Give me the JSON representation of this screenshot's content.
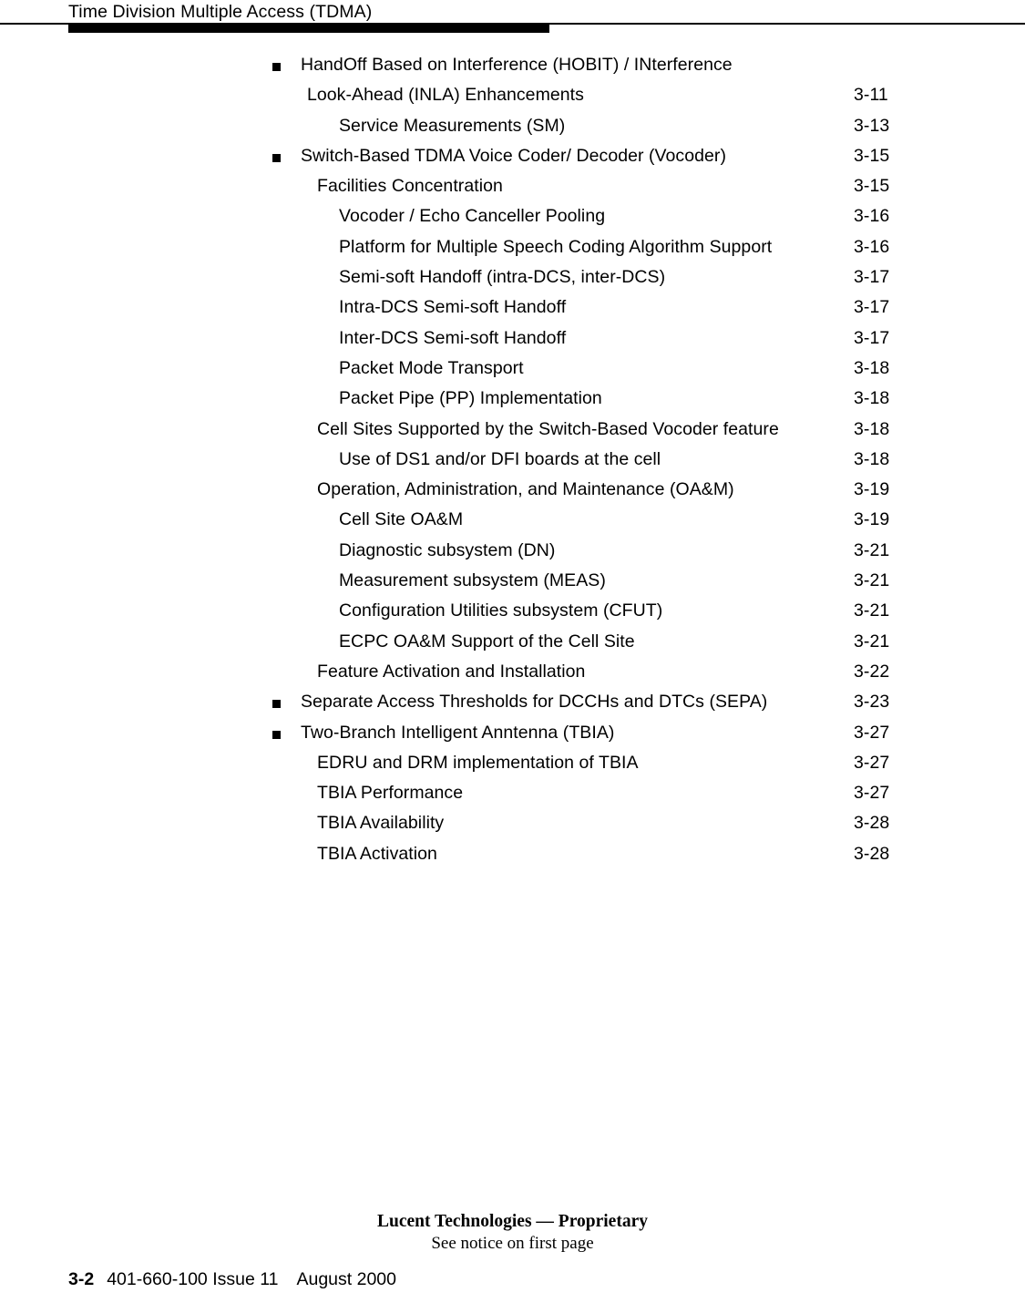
{
  "header": {
    "running_head": "Time Division Multiple Access (TDMA)"
  },
  "toc": {
    "rows": [
      {
        "level": 1,
        "bullet": true,
        "label": "HandOff Based on Interference (HOBIT) / INterference",
        "page": ""
      },
      {
        "level": "1c",
        "bullet": false,
        "label": "Look-Ahead (INLA) Enhancements",
        "page": "3-11"
      },
      {
        "level": 3,
        "bullet": false,
        "label": "Service Measurements (SM)",
        "page": "3-13"
      },
      {
        "level": 1,
        "bullet": true,
        "label": "Switch-Based TDMA Voice Coder/ Decoder (Vocoder)",
        "page": "3-15"
      },
      {
        "level": 2,
        "bullet": false,
        "label": "Facilities Concentration",
        "page": "3-15"
      },
      {
        "level": 3,
        "bullet": false,
        "label": "Vocoder / Echo Canceller Pooling",
        "page": "3-16"
      },
      {
        "level": 3,
        "bullet": false,
        "label": "Platform for Multiple Speech Coding Algorithm Support",
        "page": "3-16"
      },
      {
        "level": 3,
        "bullet": false,
        "label": "Semi-soft Handoff (intra-DCS, inter-DCS)",
        "page": "3-17"
      },
      {
        "level": 3,
        "bullet": false,
        "label": "Intra-DCS Semi-soft Handoff",
        "page": "3-17"
      },
      {
        "level": 3,
        "bullet": false,
        "label": "Inter-DCS Semi-soft Handoff",
        "page": "3-17"
      },
      {
        "level": 3,
        "bullet": false,
        "label": "Packet Mode Transport",
        "page": "3-18"
      },
      {
        "level": 3,
        "bullet": false,
        "label": "Packet Pipe (PP) Implementation",
        "page": "3-18"
      },
      {
        "level": 2,
        "bullet": false,
        "label": "Cell Sites Supported by the Switch-Based Vocoder feature",
        "page": "3-18"
      },
      {
        "level": 3,
        "bullet": false,
        "label": "Use of DS1 and/or DFI boards at the cell",
        "page": "3-18"
      },
      {
        "level": 2,
        "bullet": false,
        "label": "Operation, Administration, and Maintenance (OA&M)",
        "page": "3-19"
      },
      {
        "level": 3,
        "bullet": false,
        "label": "Cell Site OA&M",
        "page": "3-19"
      },
      {
        "level": 3,
        "bullet": false,
        "label": "Diagnostic subsystem (DN)",
        "page": "3-21"
      },
      {
        "level": 3,
        "bullet": false,
        "label": "Measurement subsystem (MEAS)",
        "page": "3-21"
      },
      {
        "level": 3,
        "bullet": false,
        "label": "Configuration Utilities subsystem (CFUT)",
        "page": "3-21"
      },
      {
        "level": 3,
        "bullet": false,
        "label": "ECPC OA&M Support of the Cell Site",
        "page": "3-21"
      },
      {
        "level": 2,
        "bullet": false,
        "label": "Feature Activation and Installation",
        "page": "3-22"
      },
      {
        "level": 1,
        "bullet": true,
        "label": "Separate Access Thresholds for DCCHs and DTCs (SEPA)",
        "page": "3-23"
      },
      {
        "level": 1,
        "bullet": true,
        "label": "Two-Branch Intelligent Anntenna (TBIA)",
        "page": "3-27"
      },
      {
        "level": 2,
        "bullet": false,
        "label": "EDRU and DRM implementation of TBIA",
        "page": "3-27"
      },
      {
        "level": 2,
        "bullet": false,
        "label": "TBIA Performance",
        "page": "3-27"
      },
      {
        "level": 2,
        "bullet": false,
        "label": "TBIA Availability",
        "page": "3-28"
      },
      {
        "level": 2,
        "bullet": false,
        "label": "TBIA Activation",
        "page": "3-28"
      }
    ]
  },
  "footer": {
    "notice_line1": "Lucent Technologies — Proprietary",
    "notice_line2": "See notice on first page",
    "page_number": "3-2",
    "document_id": "401-660-100 Issue 11",
    "date": "August 2000"
  }
}
